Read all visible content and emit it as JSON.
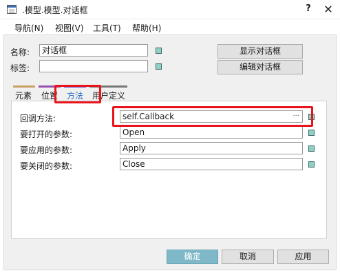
{
  "window": {
    "title": ".模型.模型.对话框",
    "help_label": "?",
    "close_label": "✕"
  },
  "menu": {
    "items": [
      {
        "label": "导航(N)"
      },
      {
        "label": "视图(V)"
      },
      {
        "label": "工具(T)"
      },
      {
        "label": "帮助(H)"
      }
    ]
  },
  "props": {
    "name_label": "名称:",
    "name_value": "对话框",
    "tag_label": "标签:",
    "tag_value": ""
  },
  "buttons": {
    "show_dialog": "显示对话框",
    "edit_dialog": "编辑对话框"
  },
  "tabs": {
    "items": [
      {
        "label": "元素",
        "color": "#c8a060"
      },
      {
        "label": "位置",
        "color": "#9a4fb0"
      },
      {
        "label": "方法",
        "color": "#6a5fd0",
        "active": true
      },
      {
        "label": "用户定义",
        "color": "#777777"
      }
    ]
  },
  "methods": {
    "rows": [
      {
        "label": "回调方法:",
        "value": "self.Callback",
        "ellipsis": "···"
      },
      {
        "label": "要打开的参数:",
        "value": "Open"
      },
      {
        "label": "要应用的参数:",
        "value": "Apply"
      },
      {
        "label": "要关闭的参数:",
        "value": "Close"
      }
    ]
  },
  "footer": {
    "ok": "确定",
    "cancel": "取消",
    "apply": "应用"
  },
  "colors": {
    "highlight": "#e8131b",
    "status_square": "#8fcfc5",
    "primary_button": "#7fb8c8"
  }
}
